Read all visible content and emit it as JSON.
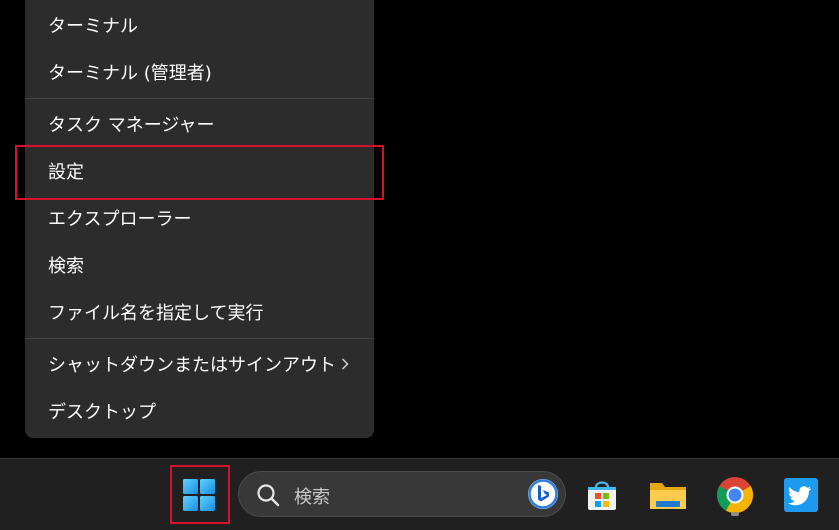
{
  "menu": {
    "items": [
      {
        "label": "ターミナル"
      },
      {
        "label": "ターミナル (管理者)"
      },
      {
        "label": "タスク マネージャー"
      },
      {
        "label": "設定"
      },
      {
        "label": "エクスプローラー"
      },
      {
        "label": "検索"
      },
      {
        "label": "ファイル名を指定して実行"
      },
      {
        "label": "シャットダウンまたはサインアウト",
        "icon": "chevron-right-icon"
      },
      {
        "label": "デスクトップ"
      }
    ],
    "highlighted": "設定"
  },
  "taskbar": {
    "start_icon": "windows-logo-icon",
    "search": {
      "placeholder": "検索",
      "icon": "search-icon",
      "bing_icon": "bing-icon"
    },
    "apps": [
      {
        "icon": "microsoft-store-icon"
      },
      {
        "icon": "file-explorer-icon"
      },
      {
        "icon": "chrome-icon",
        "running": true
      },
      {
        "icon": "twitter-icon"
      }
    ]
  },
  "colors": {
    "menu_bg": "#2c2c2c",
    "taskbar_bg": "#202020",
    "highlight": "#d4122e",
    "text": "#ffffff"
  }
}
